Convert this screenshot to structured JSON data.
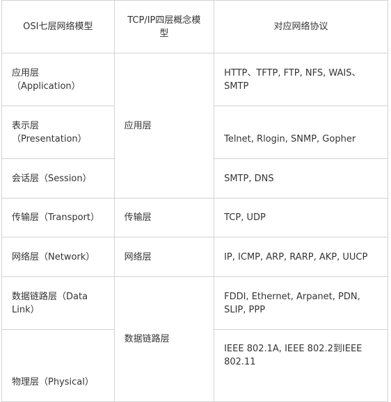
{
  "table": {
    "headers": [
      "OSI七层网络模型",
      "TCP/IP四层概念模型",
      "对应网络协议"
    ],
    "osi": {
      "application": {
        "name": "应用层",
        "en": "（Application）"
      },
      "presentation": {
        "name": "表示层",
        "en": "（Presentation）"
      },
      "session": "会话层（Session）",
      "transport": "传输层（Transport）",
      "network": "网络层（Network）",
      "datalink": "数据链路层（Data Link）",
      "physical": "物理层（Physical）"
    },
    "tcpip": {
      "application": "应用层",
      "transport": "传输层",
      "network": "网络层",
      "datalink": "数据链路层"
    },
    "protocols": {
      "application": "HTTP、TFTP, FTP, NFS, WAIS、SMTP",
      "presentation": "Telnet, Rlogin, SNMP, Gopher",
      "session": "SMTP, DNS",
      "transport": "TCP, UDP",
      "network": "IP, ICMP, ARP, RARP, AKP, UUCP",
      "datalink": "FDDI, Ethernet, Arpanet, PDN, SLIP, PPP",
      "physical": "IEEE 802.1A, IEEE 802.2到IEEE 802.11"
    }
  }
}
